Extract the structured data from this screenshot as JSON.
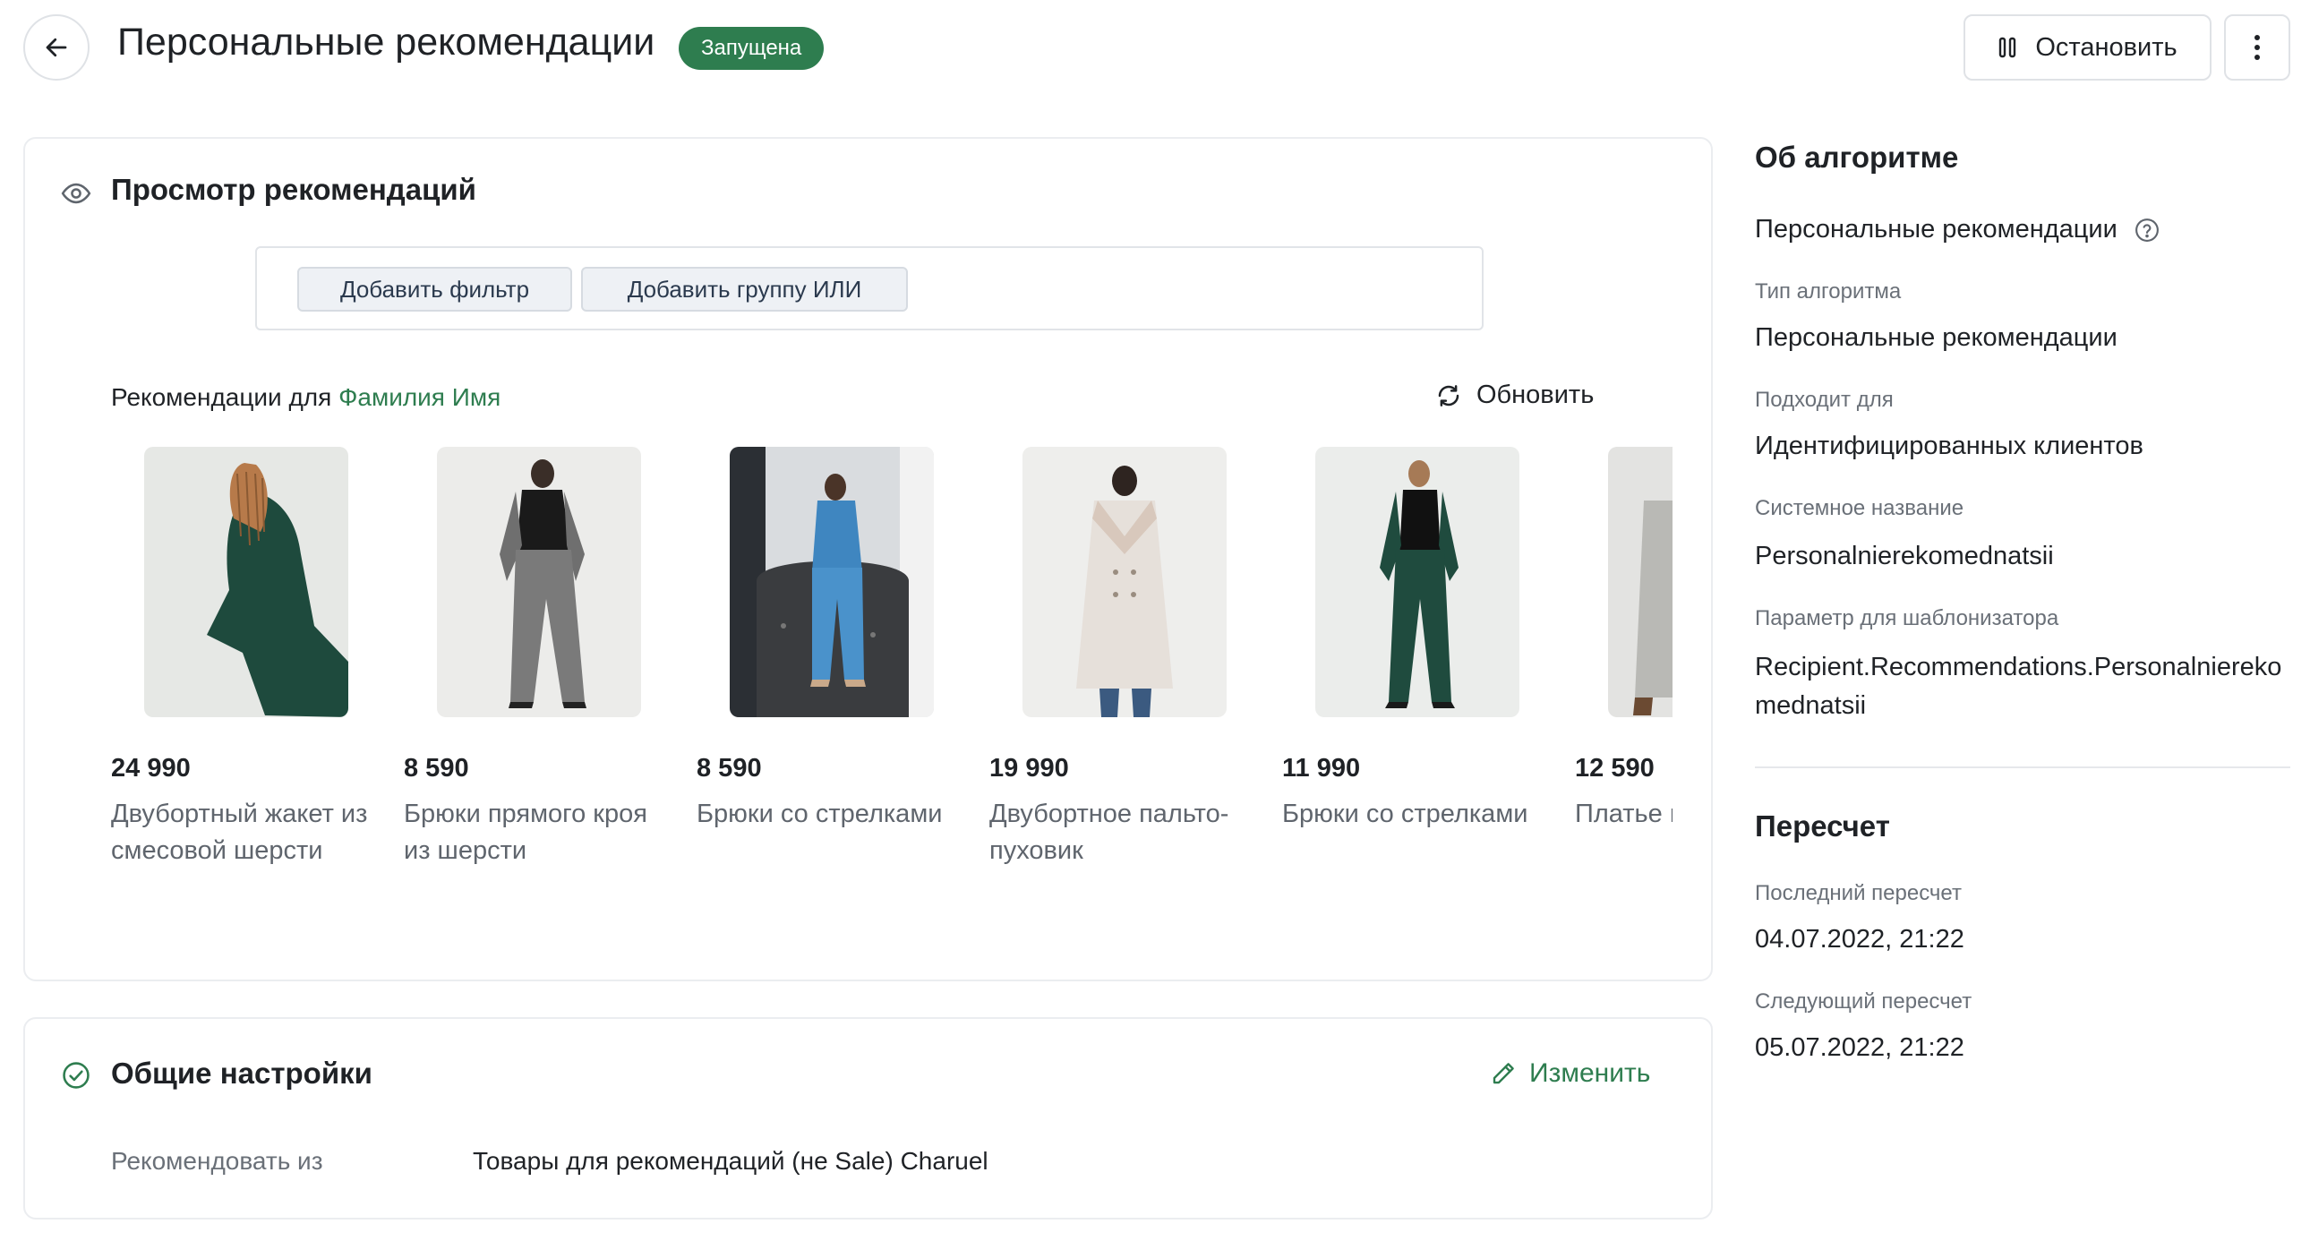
{
  "header": {
    "title": "Персональные рекомендации",
    "status": "Запущена",
    "stop_label": "Остановить",
    "colors": {
      "status": "#2e7d4f",
      "accent": "#2e7d4f"
    }
  },
  "preview": {
    "title": "Просмотр рекомендаций",
    "add_filter_label": "Добавить фильтр",
    "add_group_label": "Добавить группу ИЛИ",
    "reco_prefix": "Рекомендации для ",
    "reco_name": "Фамилия Имя",
    "refresh_label": "Обновить",
    "products": [
      {
        "price": "24 990",
        "name": "Двубортный жакет из смесовой шерсти",
        "icon": "product-photo"
      },
      {
        "price": "8 590",
        "name": "Брюки прямого кроя из шерсти",
        "icon": "product-photo"
      },
      {
        "price": "8 590",
        "name": "Брюки со стрелками",
        "icon": "product-photo"
      },
      {
        "price": "19 990",
        "name": "Двубортное пальто-пуховик",
        "icon": "product-photo"
      },
      {
        "price": "11 990",
        "name": "Брюки со стрелками",
        "icon": "product-photo"
      },
      {
        "price": "12 590",
        "name": "Платье воротник",
        "icon": "product-photo"
      }
    ]
  },
  "settings": {
    "title": "Общие настройки",
    "edit_label": "Изменить",
    "recommend_from_label": "Рекомендовать из",
    "recommend_from_value": "Товары для рекомендаций (не Sale) Charuel"
  },
  "about": {
    "title": "Об алгоритме",
    "name": "Персональные рекомендации",
    "type_label": "Тип алгоритма",
    "type_value": "Персональные рекомендации",
    "suits_label": "Подходит для",
    "suits_value": "Идентифицированных клиентов",
    "system_name_label": "Системное название",
    "system_name_value": "Personalnierekomednatsii",
    "template_param_label": "Параметр для шаблонизатора",
    "template_param_value": "Recipient.Recommendations.Personalnierekomednatsii"
  },
  "recalc": {
    "title": "Пересчет",
    "last_label": "Последний пересчет",
    "last_value": "04.07.2022, 21:22",
    "next_label": "Следующий пересчет",
    "next_value": "05.07.2022, 21:22"
  }
}
